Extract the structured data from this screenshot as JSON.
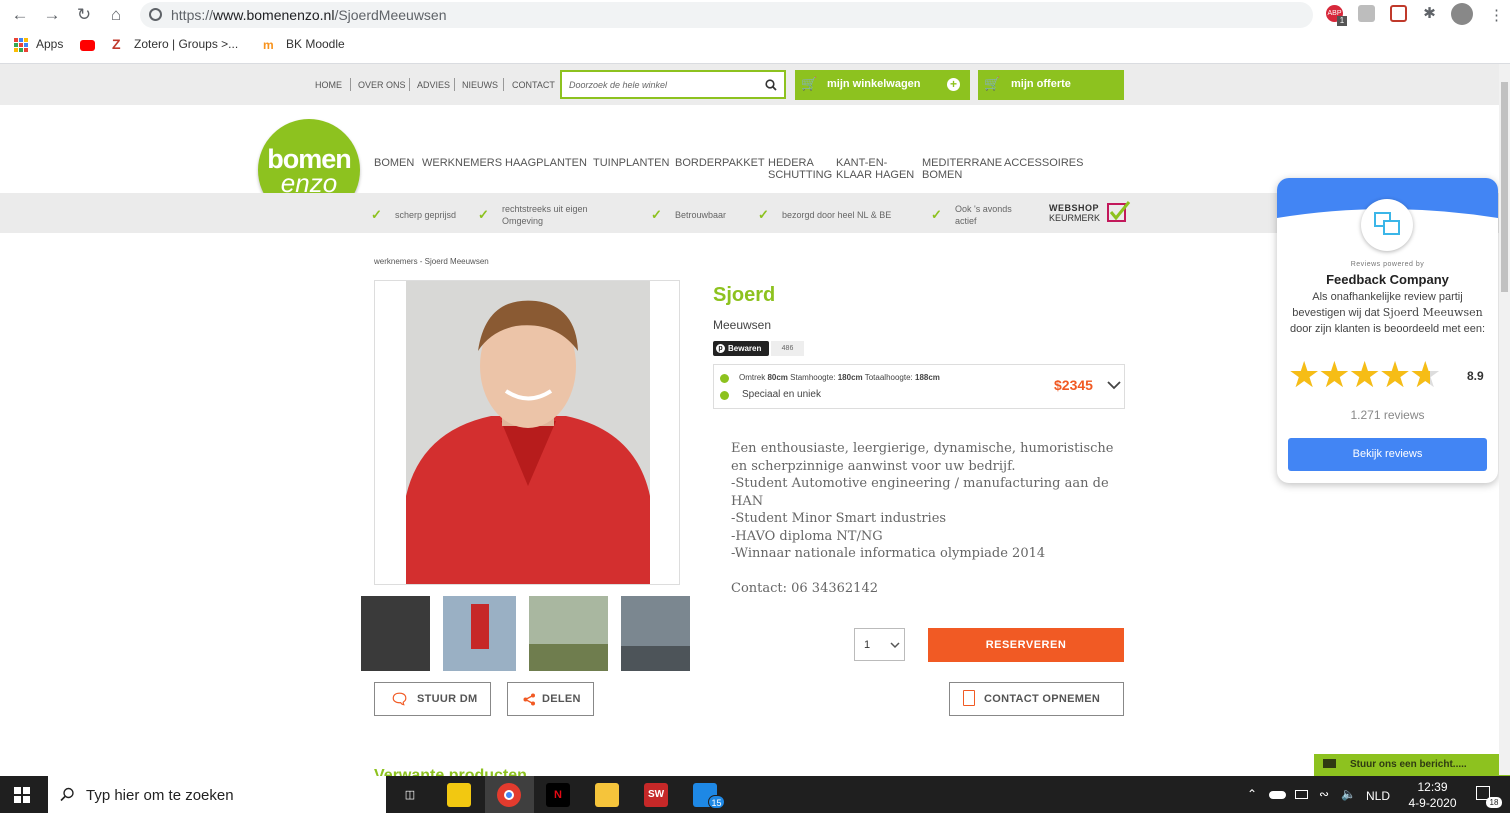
{
  "browser": {
    "url_scheme": "https://",
    "url_domain": "www.bomenenzo.nl",
    "url_path": "/SjoerdMeeuwsen",
    "extensions": {
      "abp_badge": "ABP",
      "abp_count": "1"
    },
    "bookmarks": [
      "Apps",
      "Zotero | Groups >...",
      "BK Moodle"
    ]
  },
  "site": {
    "top_nav": [
      "HOME",
      "OVER ONS",
      "ADVIES",
      "NIEUWS",
      "CONTACT"
    ],
    "search_placeholder": "Doorzoek de hele winkel",
    "cart_label": "mijn winkelwagen",
    "quote_label": "mijn offerte",
    "logo_line1": "bomen",
    "logo_line2": "enzo",
    "main_nav": [
      {
        "label": "BOMEN"
      },
      {
        "label": "WERKNEMERS"
      },
      {
        "label": "HAAGPLANTEN"
      },
      {
        "label": "TUINPLANTEN"
      },
      {
        "label": "BORDERPAKKET"
      },
      {
        "label": "HEDERA\nSCHUTTING"
      },
      {
        "label": "KANT-EN-\nKLAAR HAGEN"
      },
      {
        "label": "MEDITERRANE\nBOMEN"
      },
      {
        "label": "ACCESSOIRES"
      }
    ],
    "usps": [
      "scherp geprijsd",
      "rechtstreeks uit eigen\nOmgeving",
      "Betrouwbaar",
      "bezorgd door heel NL & BE",
      "Ook 's avonds\nactief"
    ],
    "keurmerk_line1": "WEBSHOP",
    "keurmerk_line2": "KEURMERK"
  },
  "product": {
    "breadcrumb": "werknemers - Sjoerd Meeuwsen",
    "name": "Sjoerd",
    "subtitle": "Meeuwsen",
    "pin_label": "Bewaren",
    "pin_count": "486",
    "spec_omtrek_label": "Omtrek ",
    "spec_omtrek": "80cm",
    "spec_stam_label": " Stamhoogte: ",
    "spec_stam": "180cm",
    "spec_totaal_label": " Totaalhoogte: ",
    "spec_totaal": "188cm",
    "spec2": "Speciaal en uniek",
    "price": "$2345",
    "description": [
      "Een enthousiaste, leergierige, dynamische, humoristische en scherpzinnige aanwinst voor uw bedrijf.",
      "-Student Automotive engineering / manufacturing aan de HAN",
      "-Student Minor Smart industries",
      "-HAVO diploma NT/NG",
      "-Winnaar nationale informatica olympiade 2014"
    ],
    "contact_line": "Contact: 06 34362142",
    "qty": "1",
    "reserve_label": "RESERVEREN",
    "dm_label": "STUUR DM",
    "share_label": "DELEN",
    "contact_label": "CONTACT OPNEMEN",
    "related_heading": "Verwante producten"
  },
  "feedback": {
    "powered": "Reviews powered by",
    "company": "Feedback Company",
    "text_pre": "Als onafhankelijke review partij bevestigen wij dat ",
    "text_name": "Sjoerd Meeuwsen",
    "text_post": " door zijn klanten is beoordeeld met een:",
    "score": "8.9",
    "rating_fraction": 0.89,
    "reviews": "1.271 reviews",
    "button": "Bekijk reviews"
  },
  "chat": {
    "label": "Stuur ons een bericht....."
  },
  "taskbar": {
    "search_placeholder": "Typ hier om te zoeken",
    "mail_badge": "15",
    "lang": "NLD",
    "time": "12:39",
    "date": "4-9-2020",
    "notif_badge": "18"
  },
  "colors": {
    "brand_green": "#8dc21f",
    "cta_orange": "#f15a24",
    "fb_blue": "#4285f4"
  }
}
